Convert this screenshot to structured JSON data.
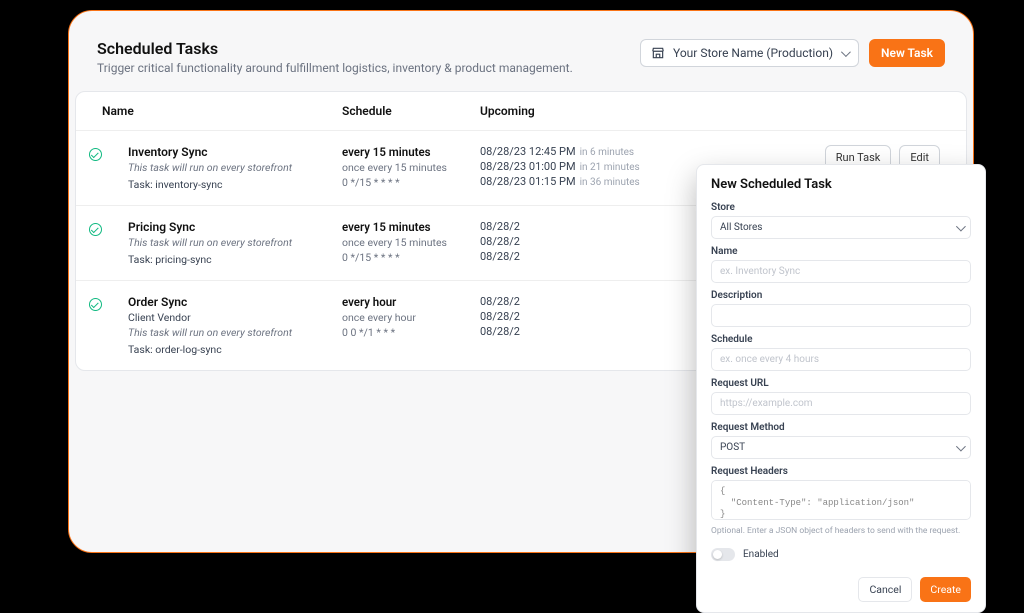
{
  "header": {
    "title": "Scheduled Tasks",
    "subtitle": "Trigger critical functionality around fulfillment logistics, inventory & product management.",
    "store_label": "Your Store Name (Production)",
    "new_task": "New Task"
  },
  "columns": {
    "name": "Name",
    "schedule": "Schedule",
    "upcoming": "Upcoming"
  },
  "actions": {
    "run": "Run Task",
    "edit": "Edit"
  },
  "tasks": [
    {
      "name": "Inventory Sync",
      "desc": "This task will run on every storefront",
      "slug": "Task: inventory-sync",
      "sched_main": "every 15 minutes",
      "sched_sub1": "once every 15 minutes",
      "sched_sub2": "0 */15 * * * *",
      "upcoming": [
        {
          "dt": "08/28/23 12:45 PM",
          "rel": "in 6 minutes"
        },
        {
          "dt": "08/28/23 01:00 PM",
          "rel": "in 21 minutes"
        },
        {
          "dt": "08/28/23 01:15 PM",
          "rel": "in 36 minutes"
        }
      ]
    },
    {
      "name": "Pricing Sync",
      "desc": "This task will run on every storefront",
      "slug": "Task: pricing-sync",
      "sched_main": "every 15 minutes",
      "sched_sub1": "once every 15 minutes",
      "sched_sub2": "0 */15 * * * *",
      "upcoming": [
        {
          "dt": "08/28/2",
          "rel": ""
        },
        {
          "dt": "08/28/2",
          "rel": ""
        },
        {
          "dt": "08/28/2",
          "rel": ""
        }
      ]
    },
    {
      "name": "Order Sync",
      "vendor": "Client Vendor",
      "desc": "This task will run on every storefront",
      "slug": "Task: order-log-sync",
      "sched_main": "every hour",
      "sched_sub1": "once every hour",
      "sched_sub2": "0 0 */1 * * *",
      "upcoming": [
        {
          "dt": "08/28/2",
          "rel": ""
        },
        {
          "dt": "08/28/2",
          "rel": ""
        },
        {
          "dt": "08/28/2",
          "rel": ""
        }
      ]
    }
  ],
  "modal": {
    "title": "New Scheduled Task",
    "store_label": "Store",
    "store_value": "All Stores",
    "name_label": "Name",
    "name_placeholder": "ex. Inventory Sync",
    "desc_label": "Description",
    "schedule_label": "Schedule",
    "schedule_placeholder": "ex. once every 4 hours",
    "url_label": "Request URL",
    "url_placeholder": "https://example.com",
    "method_label": "Request Method",
    "method_value": "POST",
    "headers_label": "Request Headers",
    "headers_value": "{\n  \"Content-Type\": \"application/json\"\n}",
    "headers_help": "Optional. Enter a JSON object of headers to send with the request.",
    "enabled_label": "Enabled",
    "cancel": "Cancel",
    "create": "Create"
  }
}
